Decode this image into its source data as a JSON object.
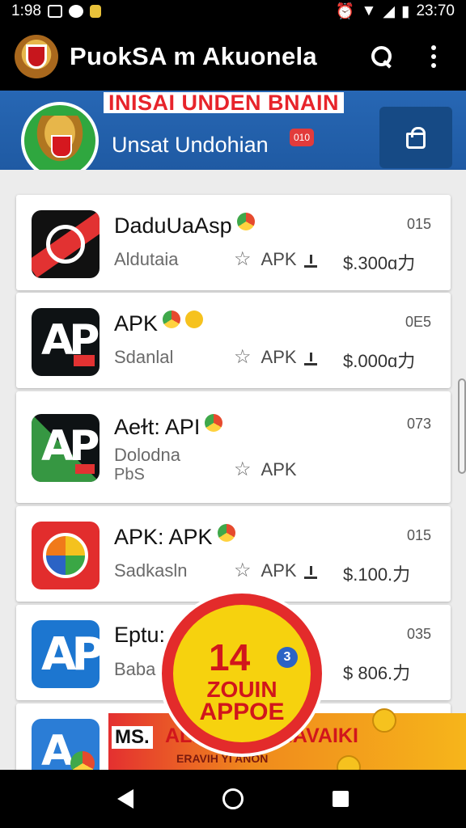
{
  "status_bar": {
    "time_left": "1:98",
    "time_right": "23:70"
  },
  "app_bar": {
    "title": "PuokSA  m Akuonela"
  },
  "banner": {
    "headline": "INISAI UNDEN BNAIN",
    "subtitle": "Unsat Undohian",
    "badge": "010"
  },
  "apps": [
    {
      "title": "DaduUaAsp",
      "subtitle": "Aldutaia",
      "type": "APK",
      "price": "$.300ɑ力",
      "code": "015"
    },
    {
      "title": "APK",
      "subtitle": "Sdanlal",
      "type": "APK",
      "price": "$.000ɑ力",
      "code": "0E5"
    },
    {
      "title": "Aeɫt: API",
      "subtitle": "Dolodna",
      "subtitle2": "PbS",
      "type": "APK",
      "price": "",
      "code": "073"
    },
    {
      "title": "APK: APK",
      "subtitle": "Sadkasln",
      "type": "APK",
      "price": "$.100.力",
      "code": "015"
    },
    {
      "title": "Eptu:",
      "subtitle": "Baba",
      "type": "",
      "price": "$ 806.力",
      "code": "035"
    }
  ],
  "promo": {
    "number": "14",
    "q": "3",
    "line1": "ZOUIN",
    "line2": "APPOE"
  },
  "strip": {
    "ms": "MS.",
    "text": "ALEUP NAE IAVAIKI",
    "sub": "ERAVIH YI ANON"
  },
  "colors": {
    "banner_blue": "#2767b4",
    "bar_black": "#000000",
    "accent_red": "#e23232",
    "promo_yellow": "#f6d20e"
  }
}
